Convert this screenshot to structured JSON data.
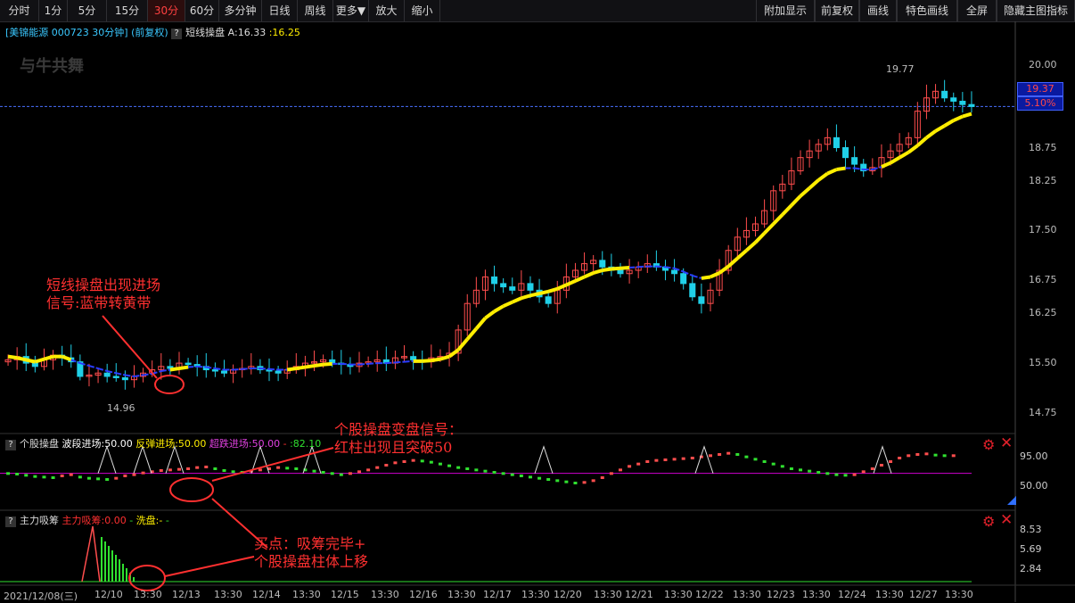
{
  "toolbar": {
    "periods": [
      "分时",
      "1分",
      "5分",
      "15分",
      "30分",
      "60分",
      "多分钟",
      "日线",
      "周线",
      "更多▼",
      "放大",
      "缩小"
    ],
    "active": "30分",
    "right": [
      "附加显示",
      "前复权",
      "画线",
      "特色画线",
      "全屏",
      "隐藏主图指标"
    ]
  },
  "header": {
    "stock": "[美锦能源",
    "code": "000723 30分钟]",
    "adj": "(前复权)",
    "q": "?",
    "indicator": "短线操盘",
    "a_label": "A:16.33",
    "b_label": ":16.25"
  },
  "watermark": "与牛共舞",
  "price_axis": {
    "ticks": [
      "20.00",
      "18.75",
      "18.25",
      "17.50",
      "16.75",
      "16.25",
      "15.50",
      "14.75"
    ],
    "current_price": "19.37",
    "current_pct": "5.10%",
    "high_label": "19.77",
    "low_label": "14.96"
  },
  "ind1": {
    "q": "?",
    "name": "个股操盘",
    "wave_label": "波段进场:50.00",
    "rebound_label": "反弹进场:50.00",
    "oversold_label": "超跌进场:50.00",
    "dash": "-",
    "value_label": ":82.10",
    "ticks": [
      "95.00",
      "50.00"
    ]
  },
  "ind2": {
    "q": "?",
    "name": "主力吸筹",
    "absorb_label": "主力吸筹:0.00",
    "dash": "-",
    "wash_label": "洗盘:-",
    "dash2": "-",
    "ticks": [
      "8.53",
      "5.69",
      "2.84"
    ]
  },
  "x_axis": [
    "2021/12/08(三)",
    "12/10",
    "13:30",
    "12/13",
    "13:30",
    "12/14",
    "13:30",
    "12/15",
    "13:30",
    "12/16",
    "13:30",
    "12/17",
    "13:30",
    "12/20",
    "13:30",
    "12/21",
    "13:30",
    "12/22",
    "13:30",
    "12/23",
    "13:30",
    "12/24",
    "13:30",
    "12/27",
    "13:30"
  ],
  "annotations": {
    "a1_line1": "短线操盘出现进场",
    "a1_line2": "信号:蓝带转黄带",
    "a2_line1": "个股操盘变盘信号：",
    "a2_line2": "红柱出现且突破50",
    "a3_line1": "买点：吸筹完毕+",
    "a3_line2": "个股操盘柱体上移"
  },
  "colors": {
    "up": "#ff4d4d",
    "down": "#20d0e8",
    "band_yellow": "#ffee00",
    "band_blue": "#2a3cff",
    "annotation": "#ff3030",
    "pink": "#d000d0",
    "green": "#30e030"
  },
  "chart_data": {
    "type": "candlestick",
    "close": [
      15.55,
      15.6,
      15.5,
      15.45,
      15.55,
      15.62,
      15.58,
      15.52,
      15.3,
      15.32,
      15.35,
      15.3,
      15.28,
      15.25,
      15.3,
      15.35,
      15.4,
      15.45,
      15.42,
      15.5,
      15.48,
      15.45,
      15.4,
      15.38,
      15.35,
      15.4,
      15.42,
      15.45,
      15.4,
      15.38,
      15.35,
      15.4,
      15.45,
      15.5,
      15.52,
      15.55,
      15.5,
      15.48,
      15.45,
      15.5,
      15.52,
      15.55,
      15.5,
      15.58,
      15.6,
      15.55,
      15.52,
      15.58,
      15.6,
      15.65,
      16.0,
      16.4,
      16.6,
      16.8,
      16.7,
      16.65,
      16.6,
      16.7,
      16.6,
      16.5,
      16.4,
      16.6,
      16.8,
      16.9,
      17.0,
      17.05,
      16.95,
      16.9,
      16.85,
      16.9,
      16.95,
      17.0,
      16.95,
      16.9,
      16.85,
      16.7,
      16.5,
      16.4,
      16.6,
      16.9,
      17.2,
      17.4,
      17.5,
      17.6,
      17.8,
      18.1,
      18.2,
      18.4,
      18.6,
      18.7,
      18.8,
      18.9,
      18.75,
      18.6,
      18.5,
      18.4,
      18.45,
      18.6,
      18.7,
      18.8,
      18.9,
      19.3,
      19.5,
      19.6,
      19.5,
      19.45,
      19.4,
      19.37
    ],
    "band": [
      15.6,
      15.58,
      15.55,
      15.52,
      15.56,
      15.6,
      15.6,
      15.55,
      15.5,
      15.46,
      15.42,
      15.38,
      15.35,
      15.32,
      15.3,
      15.32,
      15.34,
      15.38,
      15.4,
      15.42,
      15.44,
      15.45,
      15.44,
      15.42,
      15.4,
      15.4,
      15.41,
      15.42,
      15.42,
      15.41,
      15.4,
      15.4,
      15.42,
      15.44,
      15.46,
      15.48,
      15.49,
      15.49,
      15.48,
      15.48,
      15.49,
      15.5,
      15.5,
      15.51,
      15.52,
      15.53,
      15.53,
      15.54,
      15.56,
      15.6,
      15.7,
      15.86,
      16.02,
      16.18,
      16.28,
      16.36,
      16.42,
      16.48,
      16.52,
      16.55,
      16.58,
      16.62,
      16.68,
      16.74,
      16.8,
      16.86,
      16.9,
      16.92,
      16.93,
      16.94,
      16.95,
      16.96,
      16.96,
      16.95,
      16.93,
      16.88,
      16.82,
      16.78,
      16.8,
      16.86,
      16.96,
      17.08,
      17.2,
      17.32,
      17.46,
      17.6,
      17.74,
      17.88,
      18.02,
      18.14,
      18.26,
      18.36,
      18.42,
      18.44,
      18.44,
      18.42,
      18.42,
      18.46,
      18.52,
      18.6,
      18.68,
      18.78,
      18.9,
      19.0,
      19.08,
      19.16,
      19.22,
      19.26
    ],
    "band_blue_ranges": [
      [
        7,
        17
      ],
      [
        20,
        30
      ],
      [
        36,
        44
      ],
      [
        69,
        76
      ],
      [
        93,
        96
      ]
    ],
    "osc": [
      52,
      51,
      49,
      47,
      46,
      45,
      48,
      50,
      46,
      44,
      43,
      42,
      44,
      48,
      50,
      53,
      55,
      57,
      58,
      59,
      60,
      62,
      63,
      60,
      57,
      55,
      54,
      56,
      58,
      60,
      62,
      61,
      60,
      58,
      56,
      54,
      52,
      50,
      52,
      55,
      58,
      62,
      66,
      70,
      72,
      74,
      73,
      71,
      68,
      65,
      62,
      60,
      58,
      56,
      54,
      52,
      50,
      48,
      46,
      44,
      42,
      40,
      38,
      36,
      37,
      40,
      45,
      52,
      58,
      64,
      68,
      72,
      74,
      75,
      76,
      77,
      78,
      80,
      82,
      84,
      86,
      84,
      80,
      76,
      72,
      68,
      64,
      60,
      58,
      56,
      54,
      52,
      50,
      49,
      50,
      55,
      60,
      66,
      72,
      78,
      82,
      84,
      85,
      83,
      82,
      82
    ],
    "absorb": [
      0,
      0,
      0,
      0,
      0,
      0,
      0,
      0,
      0,
      0,
      0,
      0,
      0,
      0,
      0,
      0,
      0,
      0,
      0,
      0,
      0,
      0,
      0,
      0,
      0,
      0,
      0,
      0,
      0,
      0,
      0,
      0,
      0,
      0,
      0,
      0,
      0,
      0,
      0,
      0,
      0,
      0,
      0,
      0,
      0,
      0,
      0,
      0,
      0,
      0,
      0,
      0,
      0,
      0,
      0,
      0,
      0,
      0,
      0,
      0,
      0,
      0,
      0,
      0,
      0,
      0,
      0,
      0,
      0,
      0,
      0,
      0,
      0,
      0,
      0,
      0,
      0,
      0,
      0,
      0,
      0,
      0,
      0,
      0,
      0,
      0,
      0,
      0,
      0,
      0,
      0,
      0,
      0,
      0,
      0,
      0,
      0,
      0,
      0,
      0,
      0,
      0,
      0,
      0,
      0,
      0,
      0,
      0
    ],
    "ylim": [
      14.6,
      20.25
    ]
  }
}
